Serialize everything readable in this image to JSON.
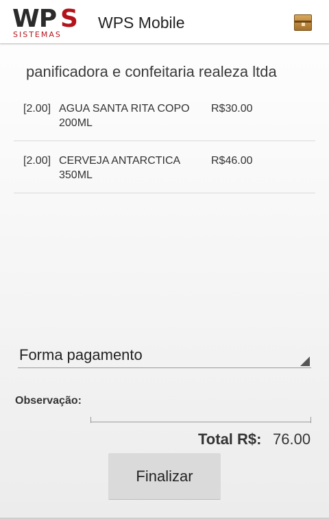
{
  "actionbar": {
    "logo_letters": "WP",
    "logo_s": "S",
    "logo_sub": "SISTEMAS",
    "title": "WPS Mobile",
    "menu_icon": "package-box-icon"
  },
  "order": {
    "company": "panificadora e confeitaria realeza ltda",
    "items": [
      {
        "qty": "[2.00]",
        "description": "AGUA SANTA RITA COPO 200ML",
        "price": "R$30.00"
      },
      {
        "qty": "[2.00]",
        "description": "CERVEJA ANTARCTICA 350ML",
        "price": "R$46.00"
      }
    ]
  },
  "payment": {
    "selected": "Forma pagamento"
  },
  "observation": {
    "label": "Observação:",
    "value": ""
  },
  "total": {
    "label": "Total R$:",
    "value": "76.00"
  },
  "actions": {
    "finalize_label": "Finalizar"
  }
}
